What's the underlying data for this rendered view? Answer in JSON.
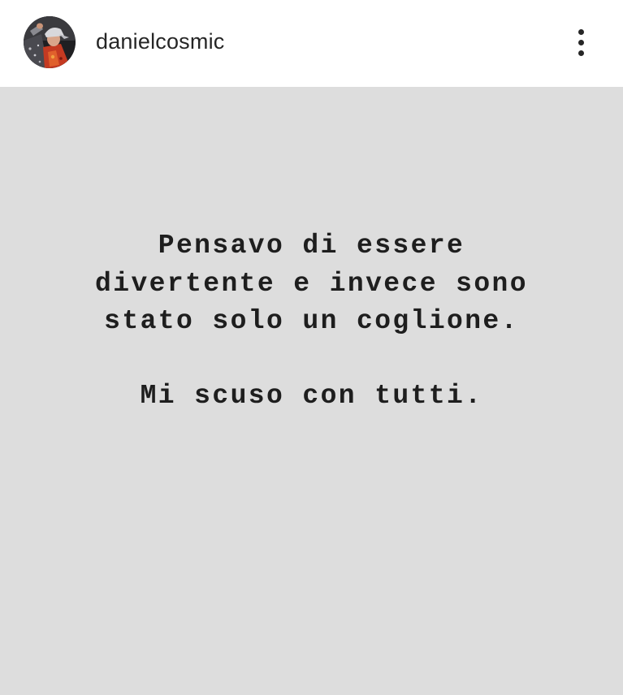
{
  "header": {
    "username": "danielcosmic",
    "avatar_icon": "profile-photo-icon",
    "more_icon": "more-vertical-icon"
  },
  "story": {
    "background_color": "#dddddd",
    "lines": [
      "Pensavo di essere",
      "divertente e invece sono",
      "stato solo un coglione.",
      "Mi scuso con tutti."
    ]
  }
}
